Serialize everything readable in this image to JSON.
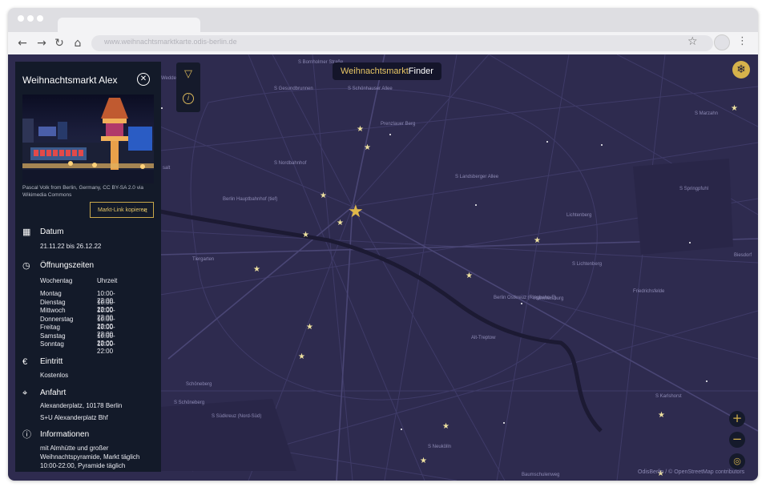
{
  "browser": {
    "url": "www.weihnachtsmarktkarte.odis-berlin.de"
  },
  "app": {
    "title_part1": "Weihnachtsmarkt",
    "title_part2": "Finder"
  },
  "panel": {
    "title": "Weihnachtsmarkt Alex",
    "caption": "Pascal Volk from Berlin, Germany, CC BY-SA 2.0 via Wikimedia Commons",
    "copy_button": "Markt-Link kopieren",
    "date": {
      "heading": "Datum",
      "value": "21.11.22 bis 26.12.22"
    },
    "hours": {
      "heading": "Öffnungszeiten",
      "col_day": "Wochentag",
      "col_time": "Uhrzeit",
      "rows": [
        {
          "day": "Montag",
          "time": "10:00-22:00"
        },
        {
          "day": "Dienstag",
          "time": "10:00-22:00"
        },
        {
          "day": "Mittwoch",
          "time": "10:00-22:00"
        },
        {
          "day": "Donnerstag",
          "time": "10:00-22:00"
        },
        {
          "day": "Freitag",
          "time": "10:00-22:00"
        },
        {
          "day": "Samstag",
          "time": "10:00-22:00"
        },
        {
          "day": "Sonntag",
          "time": "10:00-22:00"
        }
      ]
    },
    "entry": {
      "heading": "Eintritt",
      "value": "Kostenlos"
    },
    "travel": {
      "heading": "Anfahrt",
      "address": "Alexanderplatz, 10178 Berlin",
      "station": "S+U Alexanderplatz Bhf"
    },
    "info": {
      "heading": "Informationen",
      "line1": "mit Almhütte und großer",
      "line2": "Weihnachtspyramide, Markt täglich",
      "line3": "10:00-22:00, Pyramide täglich"
    }
  },
  "map": {
    "labels": {
      "bornholmer": "S Bornholmer Straße",
      "gesundbrunnen": "S Gesundbrunnen",
      "schoenhauser": "S Schönhauser Allee",
      "prenzlauer": "Prenzlauer Berg",
      "nordbahnhof": "S Nordbahnhof",
      "landsberger": "S Landsberger Allee",
      "hauptbahnhof": "Berlin Hauptbahnhof (tief)",
      "lichtenberg": "Lichtenberg",
      "tiergarten": "Tiergarten",
      "slichtenberg": "S Lichtenberg",
      "ostkreuz": "Berlin Ostkreuz (Ringbahn-F)",
      "rummelsburg": "Rummelsburg",
      "friedrichsfelde": "Friedrichsfelde",
      "alttreptow": "Alt-Treptow",
      "schoeneberg": "Schöneberg",
      "sschoeneberg": "S Schöneberg",
      "suedkreuz": "S Südkreuz (Nord-Süd)",
      "karlshorst": "S Karlshorst",
      "neukoelln": "S Neukölln",
      "marzahn": "S Marzahn",
      "springpfuhl": "S Springpfuhl",
      "biesdorf": "Biesdorf",
      "wedding": "Wedde",
      "baumschulenweg": "Baumschulenweg",
      "salt": "salt"
    },
    "attribution": "OdisBerlin / © OpenStreetMap contributors"
  },
  "icons": {
    "filter": "filter-icon",
    "info": "info-icon",
    "snowflake": "snowflake-icon",
    "close": "close-icon",
    "share": "share-icon",
    "calendar": "calendar-icon",
    "clock": "clock-icon",
    "euro": "euro-icon",
    "location": "location-pin-icon",
    "info_circle": "info-circle-icon",
    "zoom_in": "zoom-in-icon",
    "zoom_out": "zoom-out-icon",
    "locate": "locate-icon"
  },
  "colors": {
    "map_bg": "#2e2b4f",
    "panel_bg": "#131a29",
    "accent": "#d6b24b",
    "star": "#efe2a0"
  }
}
